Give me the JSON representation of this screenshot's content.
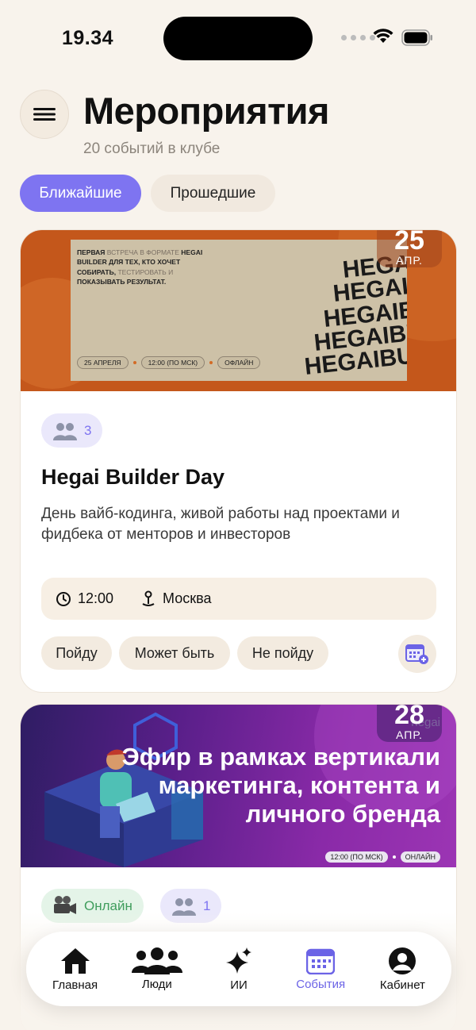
{
  "status_bar": {
    "time": "19.34"
  },
  "header": {
    "title": "Мероприятия",
    "subtitle": "20 событий в клубе"
  },
  "tabs": [
    {
      "label": "Ближайшие",
      "active": true
    },
    {
      "label": "Прошедшие",
      "active": false
    }
  ],
  "events": [
    {
      "banner": {
        "lines": [
          "ПЕРВАЯ",
          "ВСТРЕЧА В ФОРМАТЕ",
          "HEGAI BUILDER",
          "ДЛЯ ТЕХ, КТО ХОЧЕТ СОБИРАТЬ,",
          "ТЕСТИРОВАТЬ И",
          "ПОКАЗЫВАТЬ РЕЗУЛЬТАТ."
        ],
        "pills": [
          "25 АПРЕЛЯ",
          "12:00 (ПО МСК)",
          "ОФЛАЙН"
        ],
        "brand": "HEGAIBUILDER"
      },
      "date_day": "25",
      "date_month": "АПР.",
      "participants": "3",
      "title": "Hegai Builder Day",
      "description": "День вайб-кодинга, живой работы над проектами и фидбека от менторов и инвесторов",
      "time": "12:00",
      "location": "Москва",
      "rsvp": {
        "yes": "Пойду",
        "maybe": "Может быть",
        "no": "Не пойду"
      }
    },
    {
      "banner": {
        "title_lines": [
          "Эфир в рамках вертикали",
          "маркетинга, контента и",
          "личного бренда"
        ],
        "pills": [
          "12:00 (ПО МСК)",
          "ОНЛАЙН"
        ],
        "brand": "hegai"
      },
      "date_day": "28",
      "date_month": "АПР.",
      "format": "Онлайн",
      "participants": "1"
    }
  ],
  "nav": [
    {
      "label": "Главная",
      "icon": "home-icon",
      "active": false
    },
    {
      "label": "Люди",
      "icon": "people-icon",
      "active": false
    },
    {
      "label": "ИИ",
      "icon": "sparkles-icon",
      "active": false
    },
    {
      "label": "События",
      "icon": "calendar-icon",
      "active": true
    },
    {
      "label": "Кабинет",
      "icon": "profile-icon",
      "active": false
    }
  ],
  "colors": {
    "accent": "#7e74f1",
    "background": "#f8f3ec",
    "online": "#3f9d5c"
  }
}
